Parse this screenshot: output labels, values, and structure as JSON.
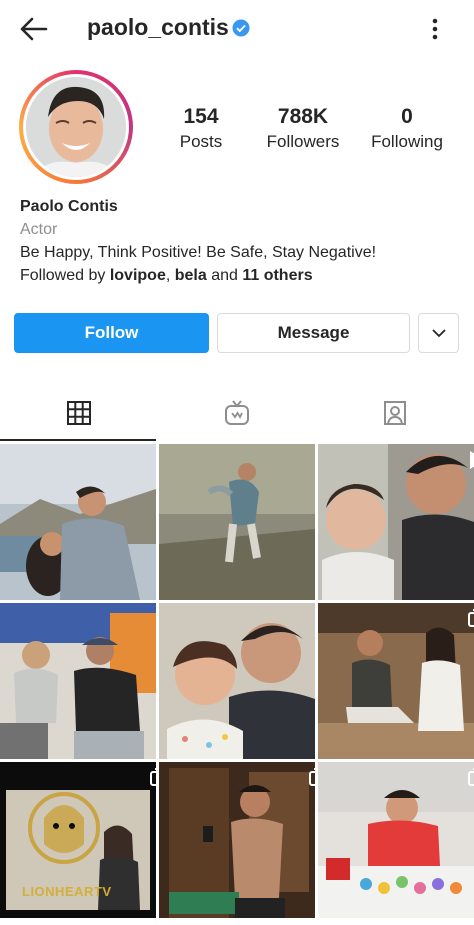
{
  "header": {
    "username": "paolo_contis",
    "back_icon": "arrow-left-icon",
    "verified_icon": "verified-badge-icon",
    "more_icon": "vertical-dots-icon"
  },
  "profile": {
    "stats": [
      {
        "value": "154",
        "label": "Posts"
      },
      {
        "value": "788K",
        "label": "Followers"
      },
      {
        "value": "0",
        "label": "Following"
      }
    ],
    "name": "Paolo Contis",
    "category": "Actor",
    "bio": "Be Happy, Think Positive! Be Safe, Stay Negative!",
    "followed_prefix": "Followed by ",
    "followed_user1": "lovipoe",
    "followed_sep": ", ",
    "followed_user2": "bela",
    "followed_and": " and ",
    "followed_others": "11 others"
  },
  "actions": {
    "follow": "Follow",
    "message": "Message"
  },
  "tabs": [
    "grid-icon",
    "igtv-icon",
    "tagged-icon"
  ],
  "overlay": {
    "lionheart": "LIONHEARTV"
  },
  "colors": {
    "accent": "#1b95f2",
    "border": "#dbdbdb",
    "verified": "#3897f0"
  }
}
